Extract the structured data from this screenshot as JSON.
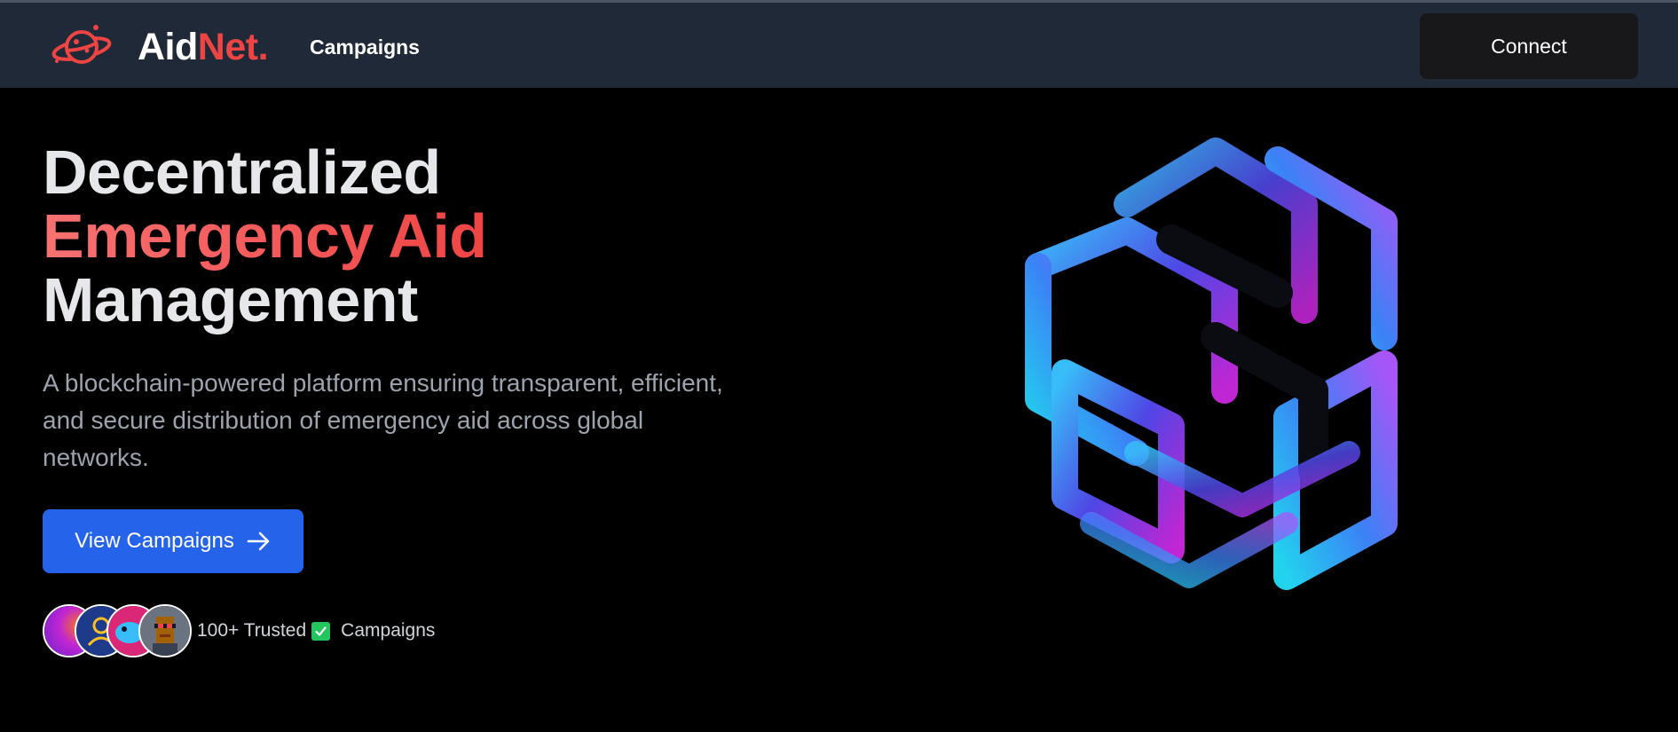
{
  "navbar": {
    "brand_primary": "Aid",
    "brand_accent": "Net.",
    "links": [
      "Campaigns"
    ],
    "connect_label": "Connect"
  },
  "hero": {
    "title_line1": "Decentralized",
    "title_line2": "Emergency Aid",
    "title_line3": "Management",
    "description": "A blockchain-powered platform ensuring transparent, efficient, and secure distribution of emergency aid across global networks.",
    "cta_label": "View Campaigns",
    "cta_icon": "arrow-right-icon",
    "trust_count": "100+ Trusted",
    "trust_icon": "check-icon",
    "trust_suffix": "Campaigns"
  },
  "colors": {
    "navbar_bg": "#1f2937",
    "accent_red": "#ef4444",
    "cta_blue": "#2563eb",
    "check_green": "#22c55e",
    "background": "#000000"
  },
  "icons": [
    "planet-logo-icon",
    "arrow-right-icon",
    "check-icon"
  ]
}
